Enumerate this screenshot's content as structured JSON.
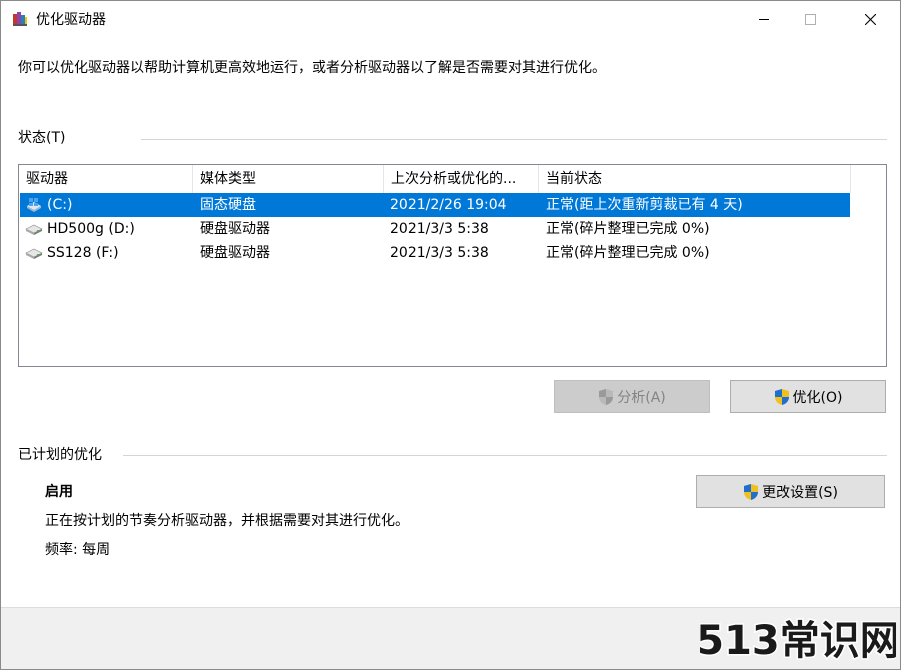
{
  "window": {
    "title": "优化驱动器"
  },
  "intro_text": "你可以优化驱动器以帮助计算机更高效地运行，或者分析驱动器以了解是否需要对其进行优化。",
  "status": {
    "header": "状态(T)",
    "columns": [
      "驱动器",
      "媒体类型",
      "上次分析或优化的...",
      "当前状态"
    ],
    "rows": [
      {
        "drive": "(C:)",
        "media": "固态硬盘",
        "last": "2021/2/26 19:04",
        "state": "正常(距上次重新剪裁已有 4 天)",
        "icon": "windows-drive-icon",
        "selected": true
      },
      {
        "drive": "HD500g (D:)",
        "media": "硬盘驱动器",
        "last": "2021/3/3 5:38",
        "state": "正常(碎片整理已完成 0%)",
        "icon": "hard-drive-icon",
        "selected": false
      },
      {
        "drive": "SS128 (F:)",
        "media": "硬盘驱动器",
        "last": "2021/3/3 5:38",
        "state": "正常(碎片整理已完成 0%)",
        "icon": "hard-drive-icon",
        "selected": false
      }
    ]
  },
  "buttons": {
    "analyze": "分析(A)",
    "optimize": "优化(O)",
    "change_settings": "更改设置(S)"
  },
  "scheduled": {
    "header": "已计划的优化",
    "state": "启用",
    "description": "正在按计划的节奏分析驱动器，并根据需要对其进行优化。",
    "frequency": "频率: 每周"
  },
  "watermark": "513常识网",
  "colors": {
    "selection": "#0078d7",
    "watermark": "#1a1a1a"
  }
}
